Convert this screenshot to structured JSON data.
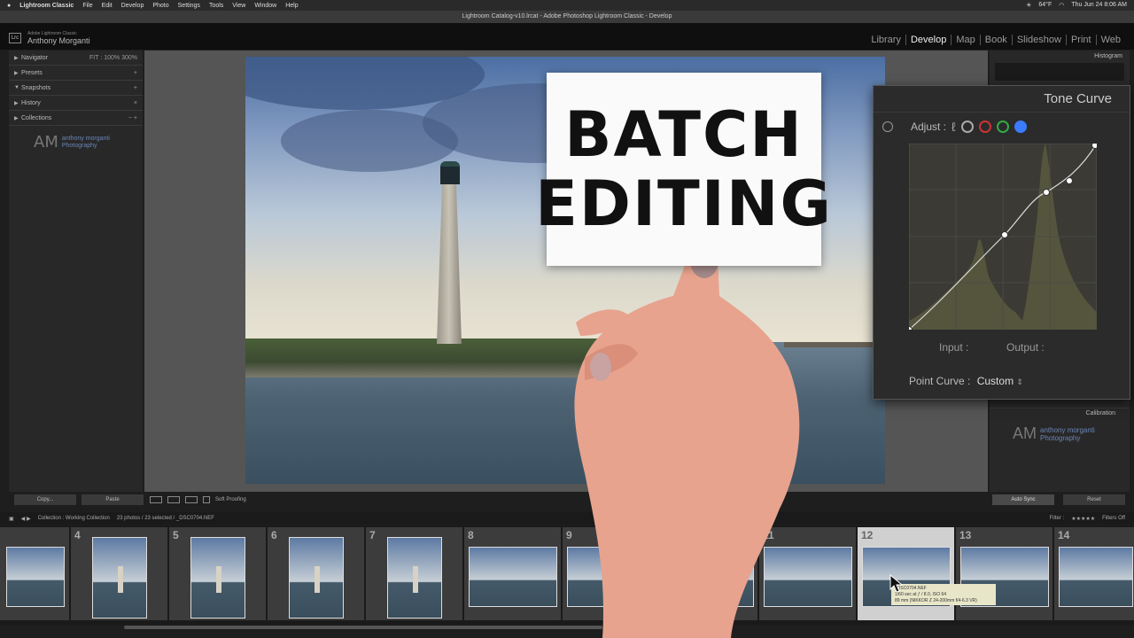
{
  "macbar": {
    "app": "Lightroom Classic",
    "menus": [
      "File",
      "Edit",
      "Develop",
      "Photo",
      "Settings",
      "Tools",
      "View",
      "Window",
      "Help"
    ],
    "weather": "64°F",
    "datetime": "Thu Jun 24  8:06 AM"
  },
  "window_title": "Lightroom Catalog-v10.lrcat - Adobe Photoshop Lightroom Classic - Develop",
  "lr": {
    "logo": "Lrc",
    "brand": "Adobe Lightroom Classic",
    "user": "Anthony Morganti",
    "modules": [
      "Library",
      "Develop",
      "Map",
      "Book",
      "Slideshow",
      "Print",
      "Web"
    ],
    "active_module": "Develop"
  },
  "left_panel": {
    "sections": [
      {
        "label": "Navigator",
        "action": "FIT : 100%  300%"
      },
      {
        "label": "Presets",
        "action": "+"
      },
      {
        "label": "Snapshots",
        "action": "+"
      },
      {
        "label": "History",
        "action": "×"
      },
      {
        "label": "Collections",
        "action": "− +"
      }
    ],
    "copy_label": "Copy...",
    "paste_label": "Paste"
  },
  "watermark": {
    "initials": "AM",
    "line1": "anthony morganti",
    "line2": "Photography"
  },
  "right_panel": {
    "histogram_label": "Histogram",
    "calibration_label": "Calibration",
    "auto_sync_label": "Auto Sync",
    "reset_label": "Reset"
  },
  "toolbar": {
    "soft_proofing": "Soft Proofing"
  },
  "filmbar": {
    "collection": "Collection : Working Collection",
    "count": "23 photos / 23 selected / _DSC0704.NEF",
    "filter_label": "Filter :",
    "filters_off": "Filters Off"
  },
  "card": {
    "line1": "BATCH",
    "line2": "EDITING"
  },
  "tone_curve": {
    "title": "Tone Curve",
    "adjust_label": "Adjust :",
    "input_label": "Input :",
    "output_label": "Output :",
    "point_curve_label": "Point Curve :",
    "point_curve_value": "Custom",
    "channel_colors": [
      "#aaaaaa",
      "#cc3333",
      "#33aa44",
      "#3b7bff"
    ]
  },
  "filmstrip": {
    "numbers": [
      "4",
      "5",
      "6",
      "7",
      "8",
      "9",
      "",
      "11",
      "12",
      "13",
      "14"
    ],
    "selected_number": "12",
    "tooltip_lines": [
      "_DSC0704.NEF",
      "1/60 sec at ƒ / 8.0, ISO 64",
      "89 mm (NIKKOR Z 24-200mm f/4-6.3 VR)"
    ]
  }
}
